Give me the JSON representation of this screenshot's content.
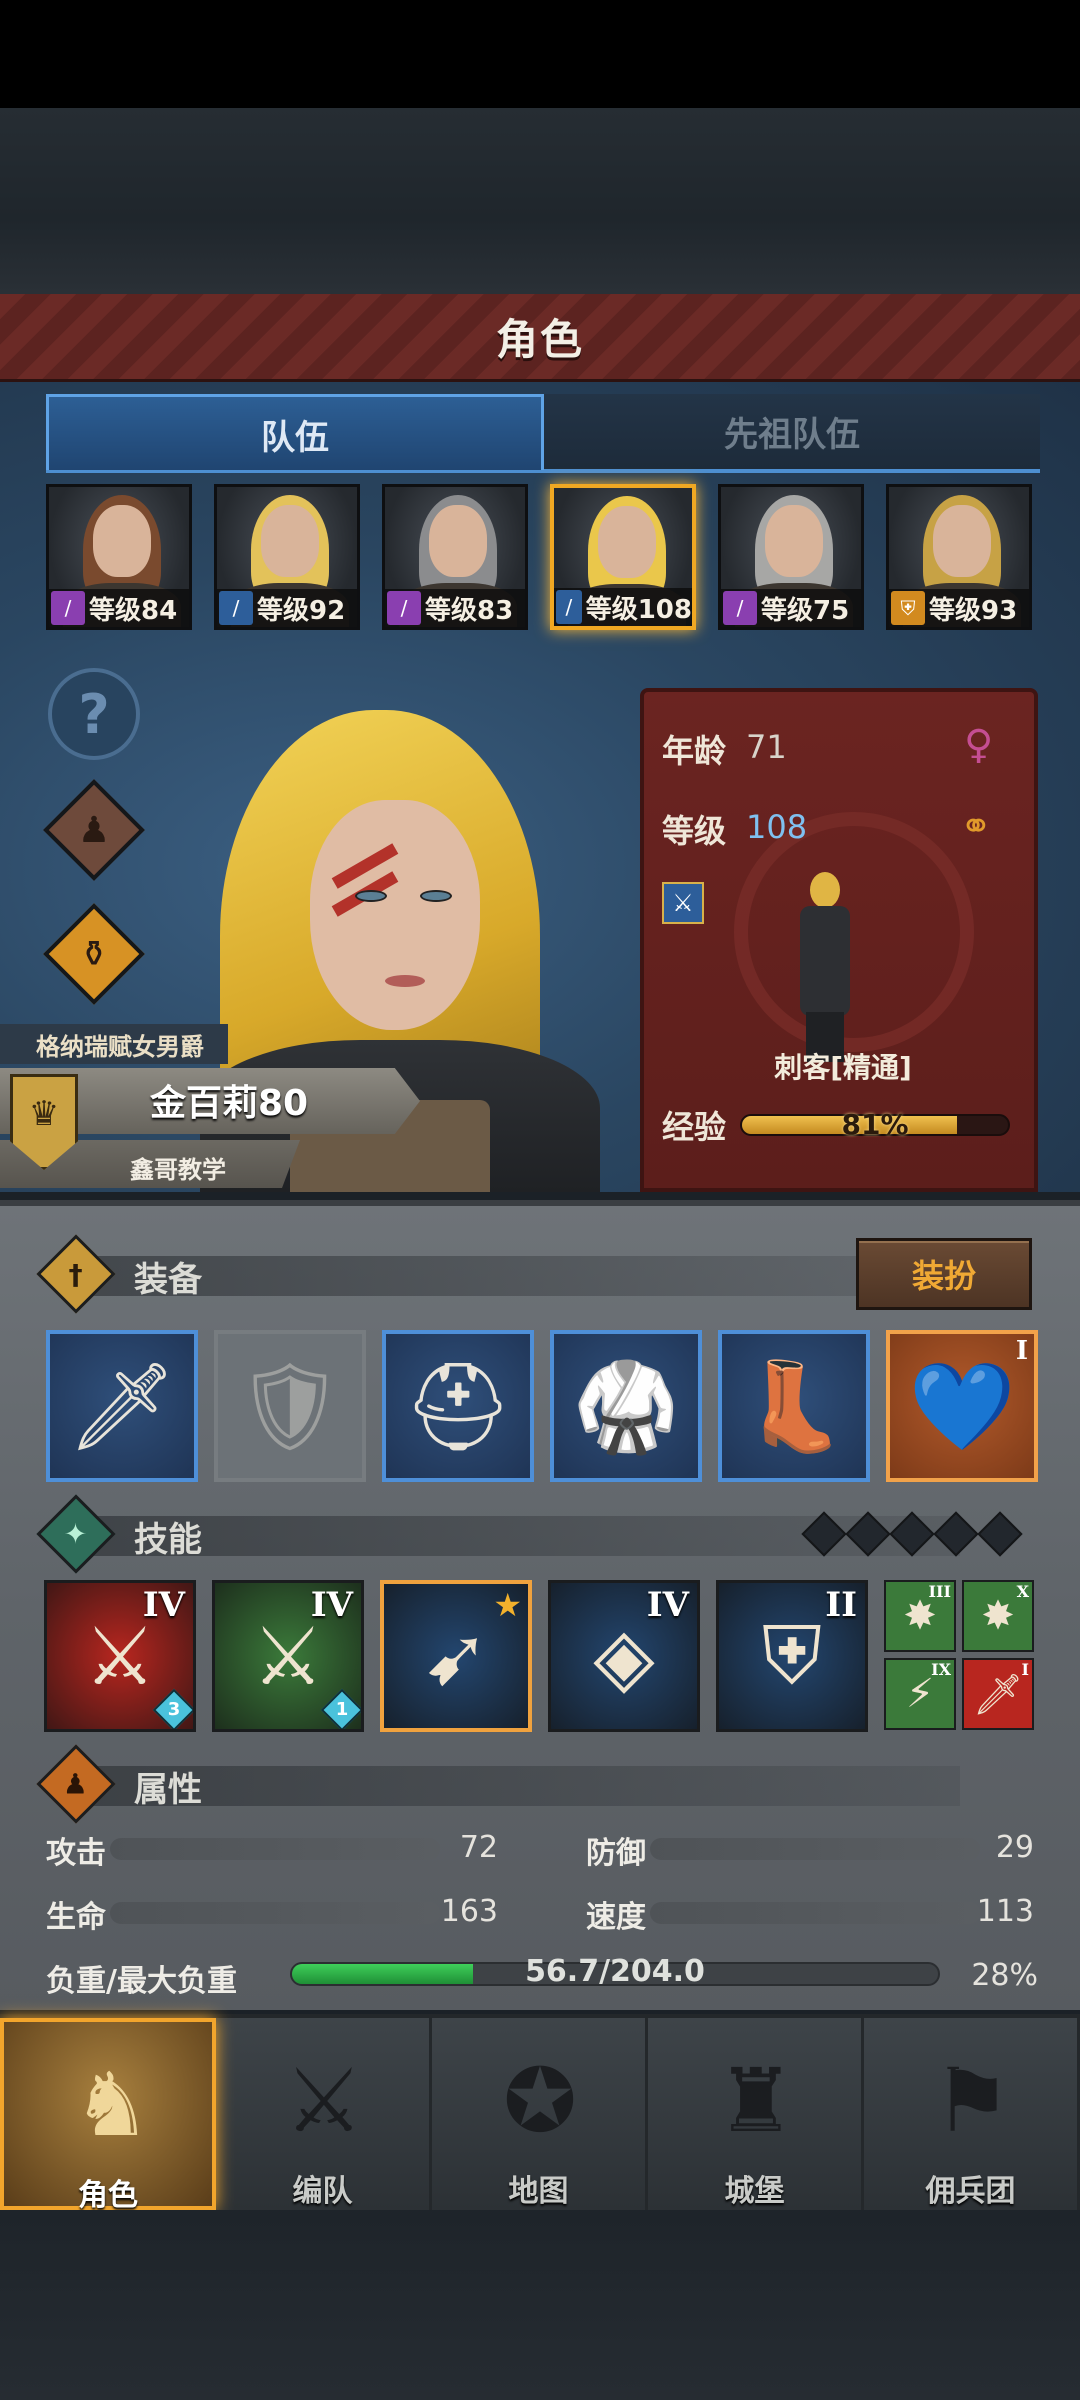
{
  "header": {
    "title": "角色"
  },
  "tabs": [
    {
      "label": "队伍",
      "active": true
    },
    {
      "label": "先祖队伍",
      "active": false
    }
  ],
  "roster": [
    {
      "level_text": "等级84",
      "class_icon": "staff-icon",
      "class_color": "#8a3fb0",
      "hair_color": "#7a4a2e",
      "selected": false
    },
    {
      "level_text": "等级92",
      "class_icon": "sword-icon",
      "class_color": "#2d5e9a",
      "hair_color": "#e3c25a",
      "selected": false
    },
    {
      "level_text": "等级83",
      "class_icon": "staff-icon",
      "class_color": "#8a3fb0",
      "hair_color": "#8b8c8e",
      "selected": false
    },
    {
      "level_text": "等级108",
      "class_icon": "dagger-icon",
      "class_color": "#2d5e9a",
      "hair_color": "#eac74b",
      "selected": true
    },
    {
      "level_text": "等级75",
      "class_icon": "staff-icon",
      "class_color": "#8a3fb0",
      "hair_color": "#a7a7a5",
      "selected": false
    },
    {
      "level_text": "等级93",
      "class_icon": "shield-icon",
      "class_color": "#d28a1f",
      "hair_color": "#c7a245",
      "selected": false
    }
  ],
  "side_buttons": {
    "help": "question-icon",
    "team": "figures-icon",
    "potion": "potion-icon"
  },
  "character": {
    "title": "格纳瑞赋女男爵",
    "name": "金百莉80",
    "guild": "鑫哥教学",
    "age_label": "年龄",
    "age": "71",
    "level_label": "等级",
    "level": "108",
    "class_name": "刺客[精通]",
    "exp_label": "经验",
    "exp_text": "81%",
    "exp_fraction": 0.81
  },
  "equipment": {
    "title": "装备",
    "dress_button": "装扮",
    "slots": [
      {
        "name": "dagger",
        "glyph": "🗡",
        "style": "blue"
      },
      {
        "name": "empty-shield",
        "glyph": "🛡",
        "style": "empty"
      },
      {
        "name": "helmet",
        "glyph": "⛑",
        "style": "blue"
      },
      {
        "name": "chest-armor",
        "glyph": "🥋",
        "style": "blue"
      },
      {
        "name": "boots",
        "glyph": "👢",
        "style": "blue"
      },
      {
        "name": "heart-amulet",
        "glyph": "💙",
        "style": "orange",
        "roman": "I"
      }
    ]
  },
  "skills": {
    "title": "技能",
    "main": [
      {
        "name": "skill-red",
        "bg": "#b8261f",
        "glyph": "⚔",
        "roman": "IV",
        "gem": "3"
      },
      {
        "name": "skill-green",
        "bg": "#3b7a3a",
        "glyph": "⚔",
        "roman": "IV",
        "gem": "1"
      },
      {
        "name": "skill-blue-dash",
        "bg": "#23466f",
        "glyph": "➹",
        "roman": "",
        "star": true
      },
      {
        "name": "skill-blue-crystal",
        "bg": "#23466f",
        "glyph": "◈",
        "roman": "IV"
      },
      {
        "name": "skill-blue-armor",
        "bg": "#23466f",
        "glyph": "⛨",
        "roman": "II"
      }
    ],
    "mini": [
      {
        "name": "mini-skill-burst-green",
        "bg": "#3b7a3a",
        "glyph": "✸",
        "roman": "III"
      },
      {
        "name": "mini-skill-burst-green-2",
        "bg": "#3b7a3a",
        "glyph": "✸",
        "roman": "X"
      },
      {
        "name": "mini-skill-strike-green",
        "bg": "#3b7a3a",
        "glyph": "⚡",
        "roman": "IX"
      },
      {
        "name": "mini-skill-dagger-red",
        "bg": "#b8261f",
        "glyph": "🗡",
        "roman": "I"
      }
    ]
  },
  "attributes": {
    "title": "属性",
    "attack_label": "攻击",
    "attack": "72",
    "defense_label": "防御",
    "defense": "29",
    "hp_label": "生命",
    "hp": "163",
    "speed_label": "速度",
    "speed": "113",
    "load_label": "负重/最大负重",
    "load_text": "56.7/204.0",
    "load_percent": "28%",
    "load_fraction": 0.28
  },
  "nav": [
    {
      "label": "角色",
      "icon": "knight-icon",
      "glyph": "♞",
      "active": true
    },
    {
      "label": "编队",
      "icon": "formation-icon",
      "glyph": "⚔",
      "active": false
    },
    {
      "label": "地图",
      "icon": "compass-map-icon",
      "glyph": "✪",
      "active": false
    },
    {
      "label": "城堡",
      "icon": "castle-icon",
      "glyph": "♜",
      "active": false
    },
    {
      "label": "佣兵团",
      "icon": "mercenary-icon",
      "glyph": "⚑",
      "active": false
    }
  ]
}
